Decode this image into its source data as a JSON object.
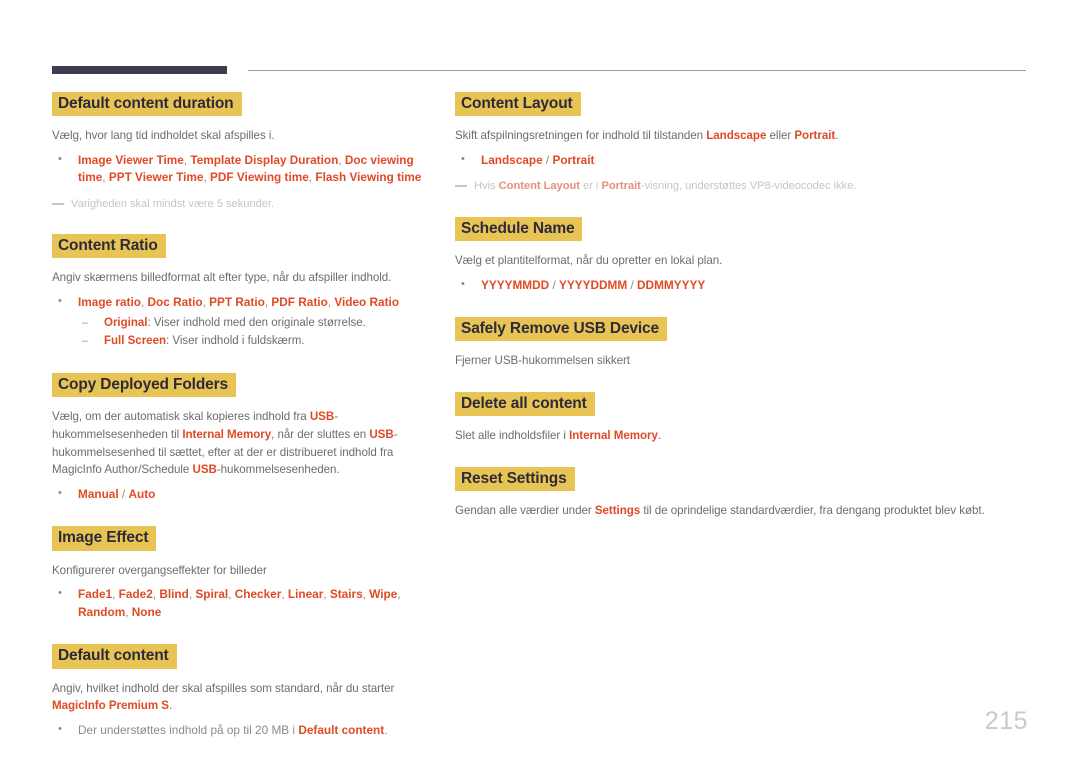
{
  "page": {
    "number": "215",
    "accent_bar_color": "#423a4f",
    "heading_highlight_color": "#e8c455",
    "heading_text_color": "#2e2a3a",
    "term_color": "#e04a25",
    "body_text_color": "#6d6d6d",
    "note_text_color": "#c6c6c6"
  },
  "left_column": [
    {
      "heading": "Default content duration",
      "body_parts": [
        {
          "text": "Vælg, hvor lang tid indholdet skal afspilles i.",
          "style": "plain"
        }
      ],
      "bullets": [
        {
          "parts": [
            {
              "text": "Image Viewer Time",
              "style": "term"
            },
            {
              "text": ", ",
              "style": "sep"
            },
            {
              "text": "Template Display Duration",
              "style": "term"
            },
            {
              "text": ", ",
              "style": "sep"
            },
            {
              "text": "Doc viewing time",
              "style": "term"
            },
            {
              "text": ", ",
              "style": "sep"
            },
            {
              "text": "PPT Viewer Time",
              "style": "term"
            },
            {
              "text": ", ",
              "style": "sep"
            },
            {
              "text": "PDF Viewing time",
              "style": "term"
            },
            {
              "text": ", ",
              "style": "sep"
            },
            {
              "text": "Flash Viewing time",
              "style": "term"
            }
          ]
        }
      ],
      "note": {
        "parts": [
          {
            "text": "Varigheden skal mindst være 5 sekunder.",
            "style": "plain"
          }
        ]
      }
    },
    {
      "heading": "Content Ratio",
      "body_parts": [
        {
          "text": "Angiv skærmens billedformat alt efter type, når du afspiller indhold.",
          "style": "plain"
        }
      ],
      "bullets": [
        {
          "parts": [
            {
              "text": "Image ratio",
              "style": "term"
            },
            {
              "text": ", ",
              "style": "sep"
            },
            {
              "text": "Doc Ratio",
              "style": "term"
            },
            {
              "text": ", ",
              "style": "sep"
            },
            {
              "text": "PPT Ratio",
              "style": "term"
            },
            {
              "text": ", ",
              "style": "sep"
            },
            {
              "text": "PDF Ratio",
              "style": "term"
            },
            {
              "text": ", ",
              "style": "sep"
            },
            {
              "text": "Video Ratio",
              "style": "term"
            }
          ],
          "sub": [
            {
              "parts": [
                {
                  "text": "Original",
                  "style": "term"
                },
                {
                  "text": ": Viser indhold med den originale størrelse.",
                  "style": "plain"
                }
              ]
            },
            {
              "parts": [
                {
                  "text": "Full Screen",
                  "style": "term"
                },
                {
                  "text": ": Viser indhold i fuldskærm.",
                  "style": "plain"
                }
              ]
            }
          ]
        }
      ]
    },
    {
      "heading": "Copy Deployed Folders",
      "body_parts": [
        {
          "text": "Vælg, om der automatisk skal kopieres indhold fra ",
          "style": "plain"
        },
        {
          "text": "USB",
          "style": "term"
        },
        {
          "text": "-hukommelsesenheden til ",
          "style": "plain"
        },
        {
          "text": "Internal Memory",
          "style": "term"
        },
        {
          "text": ", når der sluttes en ",
          "style": "plain"
        },
        {
          "text": "USB",
          "style": "term"
        },
        {
          "text": "-hukommelsesenhed til sættet, efter at der er distribueret indhold fra MagicInfo Author/Schedule ",
          "style": "plain"
        },
        {
          "text": "USB",
          "style": "term"
        },
        {
          "text": "-hukommelsesenheden.",
          "style": "plain"
        }
      ],
      "bullets": [
        {
          "parts": [
            {
              "text": "Manual",
              "style": "term"
            },
            {
              "text": " / ",
              "style": "sep"
            },
            {
              "text": "Auto",
              "style": "term"
            }
          ]
        }
      ]
    },
    {
      "heading": "Image Effect",
      "body_parts": [
        {
          "text": "Konfigurerer overgangseffekter for billeder",
          "style": "plain"
        }
      ],
      "bullets": [
        {
          "parts": [
            {
              "text": "Fade1",
              "style": "term"
            },
            {
              "text": ", ",
              "style": "sep"
            },
            {
              "text": "Fade2",
              "style": "term"
            },
            {
              "text": ", ",
              "style": "sep"
            },
            {
              "text": "Blind",
              "style": "term"
            },
            {
              "text": ", ",
              "style": "sep"
            },
            {
              "text": "Spiral",
              "style": "term"
            },
            {
              "text": ", ",
              "style": "sep"
            },
            {
              "text": "Checker",
              "style": "term"
            },
            {
              "text": ", ",
              "style": "sep"
            },
            {
              "text": "Linear",
              "style": "term"
            },
            {
              "text": ", ",
              "style": "sep"
            },
            {
              "text": "Stairs",
              "style": "term"
            },
            {
              "text": ", ",
              "style": "sep"
            },
            {
              "text": "Wipe",
              "style": "term"
            },
            {
              "text": ", ",
              "style": "sep"
            },
            {
              "text": "Random",
              "style": "term"
            },
            {
              "text": ", ",
              "style": "sep"
            },
            {
              "text": "None",
              "style": "term"
            }
          ]
        }
      ]
    },
    {
      "heading": "Default content",
      "body_parts": [
        {
          "text": "Angiv, hvilket indhold der skal afspilles som standard, når du starter ",
          "style": "plain"
        },
        {
          "text": "MagicInfo Premium S",
          "style": "term"
        },
        {
          "text": ".",
          "style": "plain"
        }
      ],
      "bullets": [
        {
          "parts": [
            {
              "text": "Der understøttes indhold på op til 20 MB i ",
              "style": "plain"
            },
            {
              "text": "Default content",
              "style": "term"
            },
            {
              "text": ".",
              "style": "plain"
            }
          ]
        }
      ]
    }
  ],
  "right_column": [
    {
      "heading": "Content Layout",
      "body_parts": [
        {
          "text": "Skift afspilningsretningen for indhold til tilstanden ",
          "style": "plain"
        },
        {
          "text": "Landscape",
          "style": "term"
        },
        {
          "text": " eller ",
          "style": "plain"
        },
        {
          "text": "Portrait",
          "style": "term"
        },
        {
          "text": ".",
          "style": "plain"
        }
      ],
      "bullets": [
        {
          "parts": [
            {
              "text": "Landscape",
              "style": "term"
            },
            {
              "text": " / ",
              "style": "sep"
            },
            {
              "text": "Portrait",
              "style": "term"
            }
          ]
        }
      ],
      "note": {
        "parts": [
          {
            "text": "Hvis ",
            "style": "plain"
          },
          {
            "text": "Content Layout",
            "style": "term"
          },
          {
            "text": " er i ",
            "style": "plain"
          },
          {
            "text": "Portrait",
            "style": "term"
          },
          {
            "text": "-visning, understøttes VP8-videocodec ikke.",
            "style": "plain"
          }
        ]
      }
    },
    {
      "heading": "Schedule Name",
      "body_parts": [
        {
          "text": "Vælg et plantitelformat, når du opretter en lokal plan.",
          "style": "plain"
        }
      ],
      "bullets": [
        {
          "parts": [
            {
              "text": "YYYYMMDD",
              "style": "term"
            },
            {
              "text": " / ",
              "style": "sep"
            },
            {
              "text": "YYYYDDMM",
              "style": "term"
            },
            {
              "text": " / ",
              "style": "sep"
            },
            {
              "text": "DDMMYYYY",
              "style": "term"
            }
          ]
        }
      ]
    },
    {
      "heading": "Safely Remove USB Device",
      "body_parts": [
        {
          "text": "Fjerner USB-hukommelsen sikkert",
          "style": "plain"
        }
      ],
      "bullets": []
    },
    {
      "heading": "Delete all content",
      "body_parts": [
        {
          "text": "Slet alle indholdsfiler i ",
          "style": "plain"
        },
        {
          "text": "Internal Memory",
          "style": "term"
        },
        {
          "text": ".",
          "style": "plain"
        }
      ],
      "bullets": []
    },
    {
      "heading": "Reset Settings",
      "body_parts": [
        {
          "text": "Gendan alle værdier under ",
          "style": "plain"
        },
        {
          "text": "Settings",
          "style": "term"
        },
        {
          "text": " til de oprindelige standardværdier, fra dengang produktet blev købt.",
          "style": "plain"
        }
      ],
      "bullets": []
    }
  ]
}
